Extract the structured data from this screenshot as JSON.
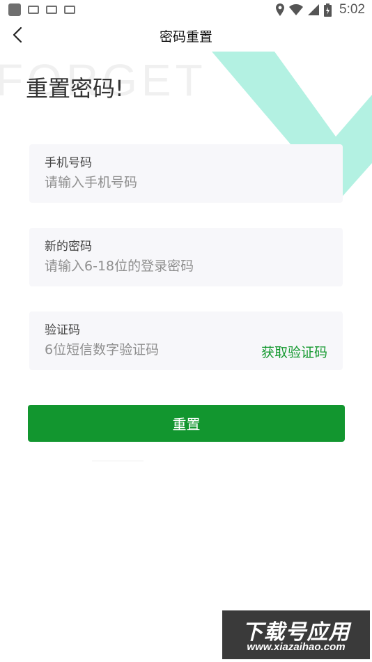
{
  "status_bar": {
    "time": "5:02"
  },
  "nav": {
    "title": "密码重置"
  },
  "background_text": "FORGET",
  "headline": "重置密码!",
  "fields": {
    "phone": {
      "label": "手机号码",
      "placeholder": "请输入手机号码"
    },
    "password": {
      "label": "新的密码",
      "placeholder": "请输入6-18位的登录密码"
    },
    "code": {
      "label": "验证码",
      "placeholder": "6位短信数字验证码",
      "action": "获取验证码"
    }
  },
  "submit_label": "重置",
  "watermark": {
    "title": "下载号应用",
    "url": "www.xiazaihao.com"
  },
  "colors": {
    "accent": "#12962f",
    "decor": "#b3f1e2",
    "field_bg": "#f7f7fa"
  },
  "icons": [
    "back-arrow-icon",
    "location-icon",
    "wifi-icon",
    "signal-icon",
    "battery-icon"
  ]
}
